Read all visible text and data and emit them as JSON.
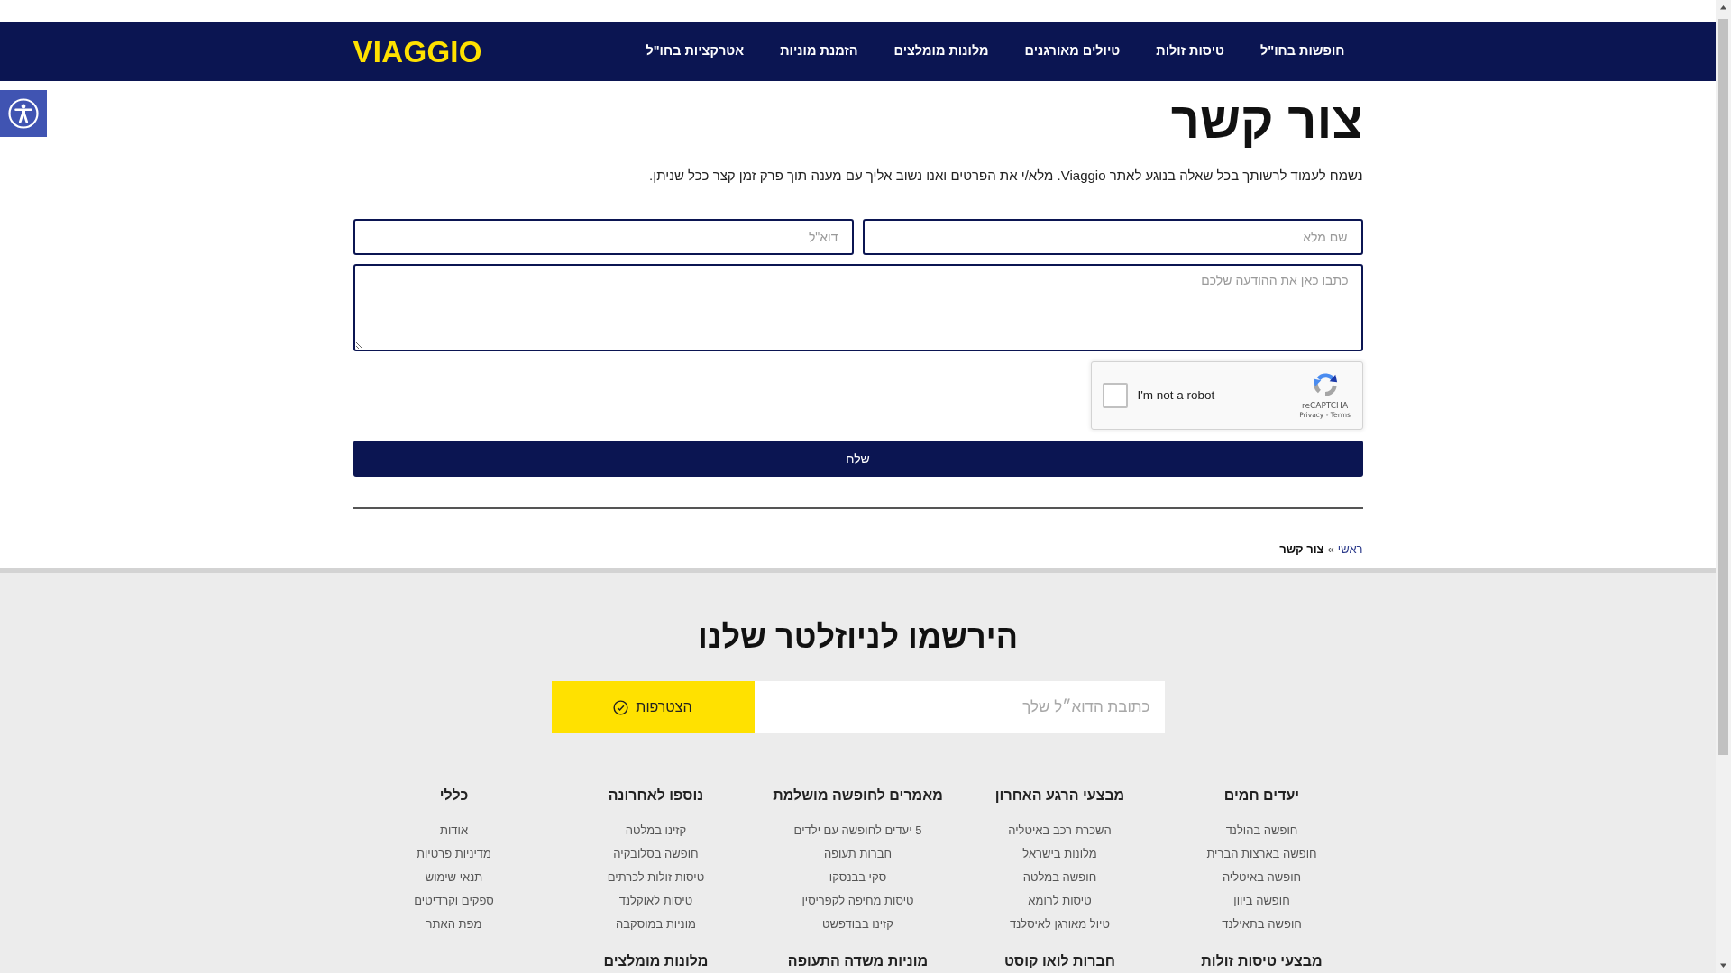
{
  "navbar": {
    "logo": "VIAGGIO",
    "items": [
      {
        "label": "חופשות בחו\"ל"
      },
      {
        "label": "טיסות זולות"
      },
      {
        "label": "טיולים מאורגנים"
      },
      {
        "label": "מלונות מומלצים"
      },
      {
        "label": "הזמנת מוניות"
      },
      {
        "label": "אטרקציות בחו\"ל"
      }
    ]
  },
  "page": {
    "title": "צור קשר",
    "intro": "נשמח לעמוד לרשותך בכל שאלה בנוגע לאתר Viaggio. מלא/י את הפרטים ואנו נשוב אליך עם מענה תוך פרק זמן קצר ככל שניתן."
  },
  "contact_form": {
    "fields": [
      {
        "placeholder": "שם מלא"
      },
      {
        "placeholder": "דוא\"ל"
      }
    ],
    "message": {
      "placeholder": "כתבו כאן את ההודעה שלכם"
    },
    "captcha": {
      "checked": false,
      "label": "I'm not a robot",
      "brand": "reCAPTCHA",
      "legal": "Privacy - Terms"
    },
    "submit": "שלח"
  },
  "breadcrumb": {
    "separator": "»",
    "items": [
      {
        "label": "ראשי",
        "kind": "link"
      },
      {
        "label": "צור קשר",
        "kind": "current"
      }
    ]
  },
  "newsletter": {
    "title": "הירשמו לניוזלטר שלנו",
    "email_placeholder": "כתובת הדוא״ל שלך",
    "button": "הצטרפות"
  },
  "footer": {
    "columns": [
      {
        "title": "יעדים חמים",
        "links": [
          "חופשה בהולנד",
          "חופשה בארצות הברית",
          "חופשה באיטליה",
          "חופשה ביוון",
          "חופשה בתאילנד"
        ]
      },
      {
        "title": "מבצעי הרגע האחרון",
        "links": [
          "השכרת רכב באיטליה",
          "מלונות בישראל",
          "חופשה במלטה",
          "טיסות לרומא",
          "טיול מאורגן לאיסלנד"
        ]
      },
      {
        "title": "מאמרים לחופשה מושלמת",
        "links": [
          "5 יעדים לחופשה עם ילדים",
          "חברות תעופה",
          "סקי בבנסקו",
          "טיסות מחיפה לקפריסין",
          "קזינו בבודפשט"
        ]
      },
      {
        "title": "נוספו לאחרונה",
        "links": [
          "קזינו במלטה",
          "חופשה בסלובקיה",
          "טיסות זולות לכרתים",
          "טיסות לאוקלנד",
          "מוניות במוסקבה"
        ]
      },
      {
        "title": "כללי",
        "links": [
          "אודות",
          "מדיניות פרטיות",
          "תנאי שימוש",
          "ספקים וקרדיטים",
          "מפת האתר"
        ]
      },
      {
        "title": "מבצעי טיסות זולות"
      },
      {
        "title": "חברות לואו קוסט"
      },
      {
        "title": "מוניות משדה התעופה"
      },
      {
        "title": "מלונות מומלצים"
      }
    ]
  }
}
